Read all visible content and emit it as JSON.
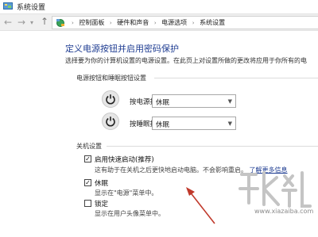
{
  "window": {
    "title": "系统设置",
    "app_icon": "control-panel-icon"
  },
  "navigation": {
    "back_icon": "back-arrow-icon",
    "forward_icon": "forward-arrow-icon",
    "history_icon": "chevron-down-icon",
    "up_icon": "up-arrow-icon",
    "breadcrumb": [
      "控制面板",
      "硬件和声音",
      "电源选项",
      "系统设置"
    ],
    "separator": "›"
  },
  "page": {
    "heading": "定义电源按钮并启用密码保护",
    "description": "选择要为你的计算机设置的电源设置。在此页上对设置所做的更改将应用于你所有的电"
  },
  "power_buttons": {
    "section_title": "电源按钮和睡眠按钮设置",
    "rows": [
      {
        "label": "按电源按钮时:",
        "value": "休眠",
        "icon": "power-icon"
      },
      {
        "label": "按睡眠按钮时:",
        "value": "休眠",
        "icon": "sleep-power-icon"
      }
    ]
  },
  "shutdown": {
    "section_title": "关机设置",
    "options": [
      {
        "label": "启用快速启动(推荐)",
        "checked": true,
        "description": "这有助于在关机之后更快地启动电脑。不会影响重启。",
        "link": "了解更多信息"
      },
      {
        "label": "休眠",
        "checked": true,
        "description": "显示在\"电源\"菜单中。"
      },
      {
        "label": "锁定",
        "checked": false,
        "description": "显示在用户头像菜单中。"
      }
    ]
  },
  "annotation": {
    "color": "#c0392b"
  },
  "watermark": {
    "text": "www.xiazaiba.com",
    "color": "#c4c4c4"
  }
}
